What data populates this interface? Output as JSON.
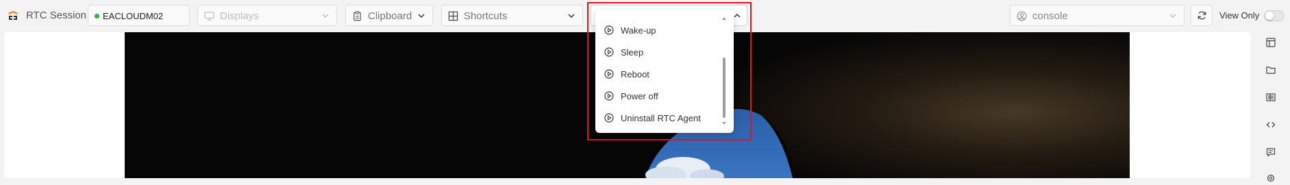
{
  "app": {
    "title": "RTC Session"
  },
  "toolbar": {
    "machine": {
      "name": "EACLOUDM02",
      "status_color": "#2fb344"
    },
    "displays": {
      "label": "Displays",
      "icon": "monitor-icon"
    },
    "clipboard": {
      "label": "Clipboard",
      "icon": "clipboard-icon"
    },
    "shortcuts": {
      "label": "Shortcuts",
      "icon": "windows-icon"
    },
    "actions": {
      "label": ""
    },
    "user": {
      "label": "console",
      "icon": "user-circle-icon"
    },
    "view_only": {
      "label": "View Only",
      "enabled": false
    }
  },
  "actions_menu": {
    "items": [
      {
        "label": "Wake-up",
        "icon": "play-circle-icon"
      },
      {
        "label": "Sleep",
        "icon": "play-circle-icon"
      },
      {
        "label": "Reboot",
        "icon": "play-circle-icon"
      },
      {
        "label": "Power off",
        "icon": "play-circle-icon"
      },
      {
        "label": "Uninstall RTC Agent",
        "icon": "play-circle-icon"
      }
    ]
  },
  "right_rail": {
    "icons": [
      "panel-icon",
      "folder-icon",
      "list-icon",
      "code-icon",
      "chat-icon",
      "gear-icon"
    ]
  },
  "colors": {
    "accent_orange": "#f2711c",
    "highlight_red": "#e0141c",
    "desktop_sky": "#2f66b1"
  }
}
